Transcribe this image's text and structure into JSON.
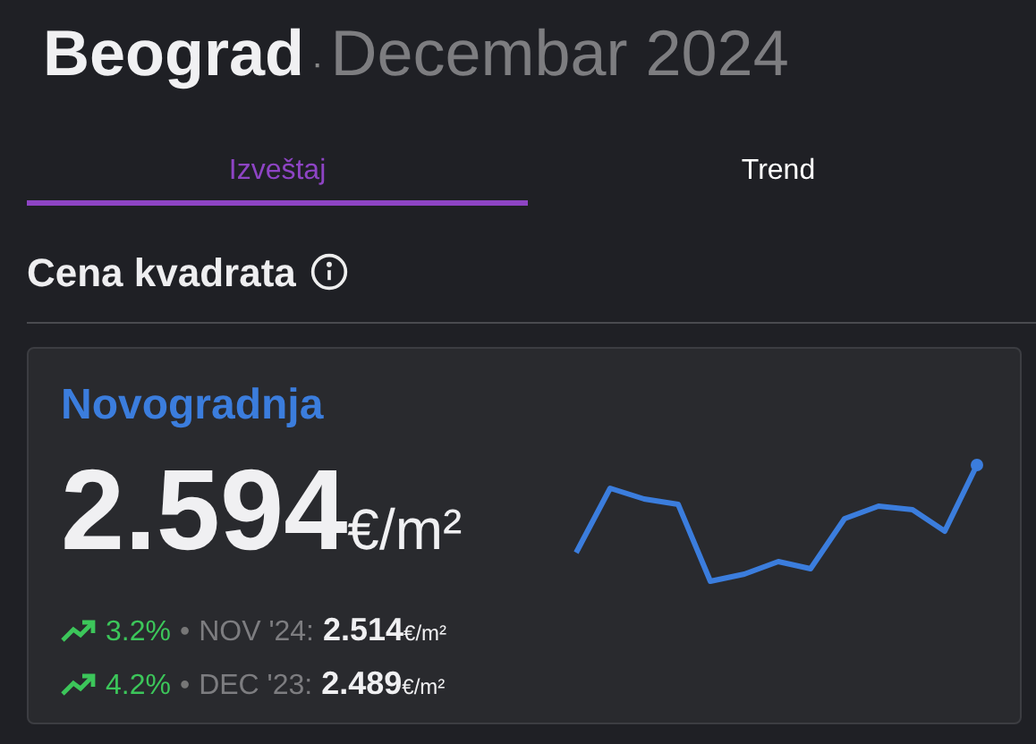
{
  "header": {
    "city": "Beograd",
    "separator": "·",
    "period": "Decembar 2024"
  },
  "tabs": [
    {
      "label": "Izveštaj",
      "selected": true
    },
    {
      "label": "Trend",
      "selected": false
    }
  ],
  "section": {
    "title": "Cena kvadrata"
  },
  "card": {
    "title": "Novogradnja",
    "value": "2.594",
    "unit": "€/m²",
    "changes": [
      {
        "percent": "3.2%",
        "bullet": "•",
        "period": "NOV '24:",
        "value": "2.514",
        "unit": "€/m²"
      },
      {
        "percent": "4.2%",
        "bullet": "•",
        "period": "DEC '23:",
        "value": "2.489",
        "unit": "€/m²"
      }
    ]
  }
}
